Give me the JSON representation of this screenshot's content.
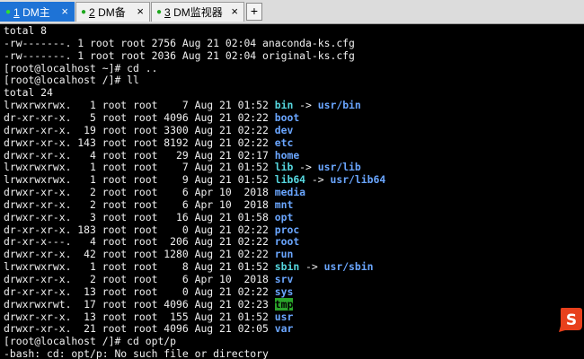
{
  "tabs": [
    {
      "num": "1",
      "label": " DM主",
      "active": true
    },
    {
      "num": "2",
      "label": " DM备",
      "active": false
    },
    {
      "num": "3",
      "label": " DM监视器",
      "active": false
    }
  ],
  "add_tab_label": "+",
  "close_glyph": "×",
  "ime_glyph": "S",
  "colors": {
    "active_tab": "#1e73d6",
    "symlink": "#56d8e0",
    "directory": "#6aa6ff",
    "sticky_bg": "#2aa32a",
    "ime": "#e8401c"
  },
  "terminal": {
    "lines": [
      {
        "text": "total 8"
      },
      {
        "text": "-rw-------. 1 root root 2756 Aug 21 02:04 anaconda-ks.cfg"
      },
      {
        "text": "-rw-------. 1 root root 2036 Aug 21 02:04 original-ks.cfg"
      },
      {
        "text": "[root@localhost ~]# cd .."
      },
      {
        "text": "[root@localhost /]# ll"
      },
      {
        "text": "total 24"
      },
      {
        "text": "lrwxrwxrwx.   1 root root    7 Aug 21 01:52 ",
        "name": "bin",
        "type": "link",
        "target": "usr/bin"
      },
      {
        "text": "dr-xr-xr-x.   5 root root 4096 Aug 21 02:22 ",
        "name": "boot",
        "type": "dir"
      },
      {
        "text": "drwxr-xr-x.  19 root root 3300 Aug 21 02:22 ",
        "name": "dev",
        "type": "dir"
      },
      {
        "text": "drwxr-xr-x. 143 root root 8192 Aug 21 02:22 ",
        "name": "etc",
        "type": "dir"
      },
      {
        "text": "drwxr-xr-x.   4 root root   29 Aug 21 02:17 ",
        "name": "home",
        "type": "dir"
      },
      {
        "text": "lrwxrwxrwx.   1 root root    7 Aug 21 01:52 ",
        "name": "lib",
        "type": "link",
        "target": "usr/lib"
      },
      {
        "text": "lrwxrwxrwx.   1 root root    9 Aug 21 01:52 ",
        "name": "lib64",
        "type": "link",
        "target": "usr/lib64"
      },
      {
        "text": "drwxr-xr-x.   2 root root    6 Apr 10  2018 ",
        "name": "media",
        "type": "dir"
      },
      {
        "text": "drwxr-xr-x.   2 root root    6 Apr 10  2018 ",
        "name": "mnt",
        "type": "dir"
      },
      {
        "text": "drwxr-xr-x.   3 root root   16 Aug 21 01:58 ",
        "name": "opt",
        "type": "dir"
      },
      {
        "text": "dr-xr-xr-x. 183 root root    0 Aug 21 02:22 ",
        "name": "proc",
        "type": "dir"
      },
      {
        "text": "dr-xr-x---.   4 root root  206 Aug 21 02:22 ",
        "name": "root",
        "type": "dir"
      },
      {
        "text": "drwxr-xr-x.  42 root root 1280 Aug 21 02:22 ",
        "name": "run",
        "type": "dir"
      },
      {
        "text": "lrwxrwxrwx.   1 root root    8 Aug 21 01:52 ",
        "name": "sbin",
        "type": "link",
        "target": "usr/sbin"
      },
      {
        "text": "drwxr-xr-x.   2 root root    6 Apr 10  2018 ",
        "name": "srv",
        "type": "dir"
      },
      {
        "text": "dr-xr-xr-x.  13 root root    0 Aug 21 02:22 ",
        "name": "sys",
        "type": "dir"
      },
      {
        "text": "drwxrwxrwt.  17 root root 4096 Aug 21 02:23 ",
        "name": "tmp",
        "type": "sticky"
      },
      {
        "text": "drwxr-xr-x.  13 root root  155 Aug 21 01:52 ",
        "name": "usr",
        "type": "dir"
      },
      {
        "text": "drwxr-xr-x.  21 root root 4096 Aug 21 02:05 ",
        "name": "var",
        "type": "dir"
      },
      {
        "text": "[root@localhost /]# cd opt/p"
      },
      {
        "text": "-bash: cd: opt/p: No such file or directory"
      }
    ]
  }
}
